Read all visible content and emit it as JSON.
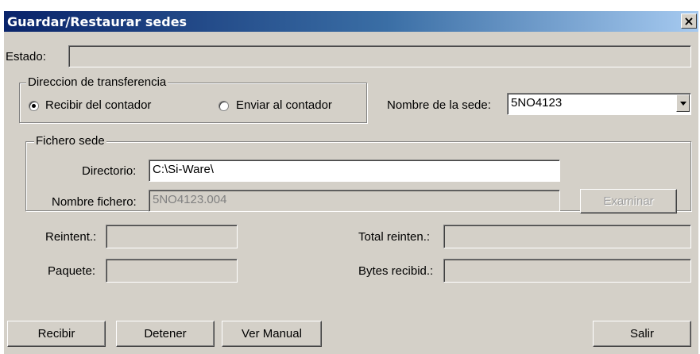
{
  "window": {
    "title": "Guardar/Restaurar sedes",
    "close_glyph": "×"
  },
  "estado": {
    "label": "Estado:",
    "value": ""
  },
  "direccion": {
    "legend": "Direccion de transferencia",
    "options": [
      {
        "label": "Recibir del contador",
        "selected": true
      },
      {
        "label": "Enviar al contador",
        "selected": false
      }
    ]
  },
  "sede": {
    "label": "Nombre de la sede:",
    "selected": "5NO4123"
  },
  "fichero": {
    "legend": "Fichero sede",
    "directorio_label": "Directorio:",
    "directorio_value": "C:\\Si-Ware\\",
    "nombre_label": "Nombre fichero:",
    "nombre_value": "5NO4123.004",
    "examinar_label": "Examinar"
  },
  "stats": {
    "reintent_label": "Reintent.:",
    "reintent_value": "",
    "paquete_label": "Paquete:",
    "paquete_value": "",
    "total_label": "Total reinten.:",
    "total_value": "",
    "bytes_label": "Bytes recibid.:",
    "bytes_value": ""
  },
  "buttons": {
    "recibir": "Recibir",
    "detener": "Detener",
    "ver_manual": "Ver Manual",
    "salir": "Salir"
  },
  "colors": {
    "dialog_bg": "#d4d0c8",
    "title_bar": "#0a246a"
  }
}
